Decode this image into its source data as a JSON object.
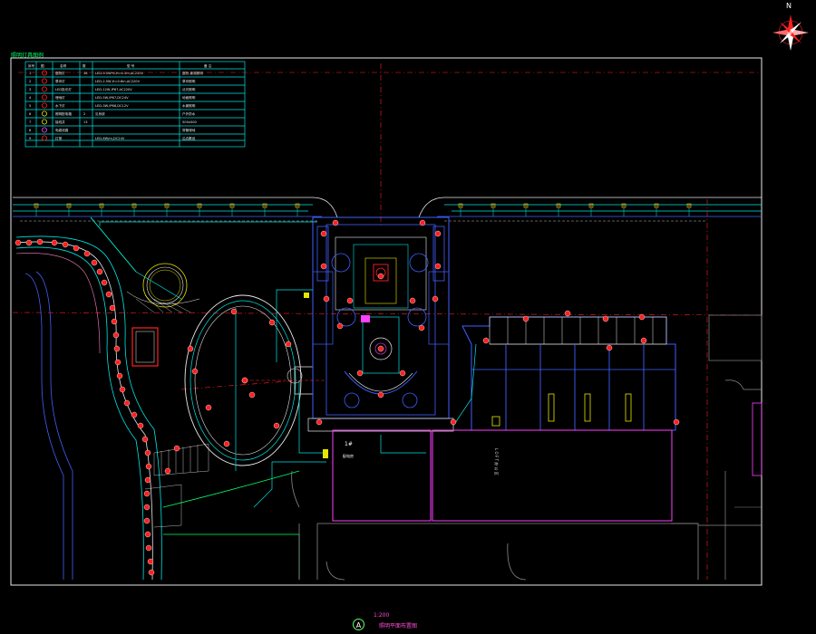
{
  "drawing": {
    "legend_title": "照明灯具图例",
    "north_label": "N",
    "sheet_code": "A",
    "sheet_title": "1:200",
    "sheet_subtitle": "照明平面布置图"
  },
  "legend": {
    "headers": [
      "序号",
      "图",
      "名称",
      "数",
      "型  号",
      "备  注"
    ],
    "rows": [
      {
        "no": "1",
        "name": "庭院灯",
        "qty": "36",
        "model": "LED-3.5W*4,H=4.5m,AC220V",
        "note": "庭院-景观照明"
      },
      {
        "no": "2",
        "name": "草坪灯",
        "qty": "",
        "model": "LED-2.5W,H=0.6m,AC220V",
        "note": "草坪照明"
      },
      {
        "no": "3",
        "name": "LED投光灯",
        "qty": "",
        "model": "LED-12W,IP67,AC220V",
        "note": "泛光照明"
      },
      {
        "no": "4",
        "name": "埋地灯",
        "qty": "",
        "model": "LED-5W,IP67,DC24V",
        "note": "地面照明"
      },
      {
        "no": "5",
        "name": "水下灯",
        "qty": "",
        "model": "LED-3W,IP68,DC12V",
        "note": "水景照明"
      },
      {
        "no": "6",
        "name": "照明配电箱",
        "qty": "2",
        "model": "见系统",
        "note": "户外防水"
      },
      {
        "no": "7",
        "name": "接线井",
        "qty": "13",
        "model": "",
        "note": "500x500"
      },
      {
        "no": "8",
        "name": "电缆线路",
        "qty": "",
        "model": "",
        "note": "穿管埋地"
      },
      {
        "no": "9",
        "name": "灯带",
        "qty": "",
        "model": "LED-6W/m,DC24V",
        "note": "沿边敷设"
      }
    ]
  },
  "labels": {
    "building_a": "1#",
    "building_a_note": "配电房",
    "building_b": "L O F T 办 公 区"
  },
  "colors": {
    "cyan": "#00e5e5",
    "red": "#ff2020",
    "white": "#e8e8e8",
    "magenta": "#ff40ff",
    "blue": "#4060ff",
    "yellow": "#e6e600",
    "green": "#00ff66",
    "pink": "#ff80c0",
    "grey": "#8a8a8a"
  }
}
